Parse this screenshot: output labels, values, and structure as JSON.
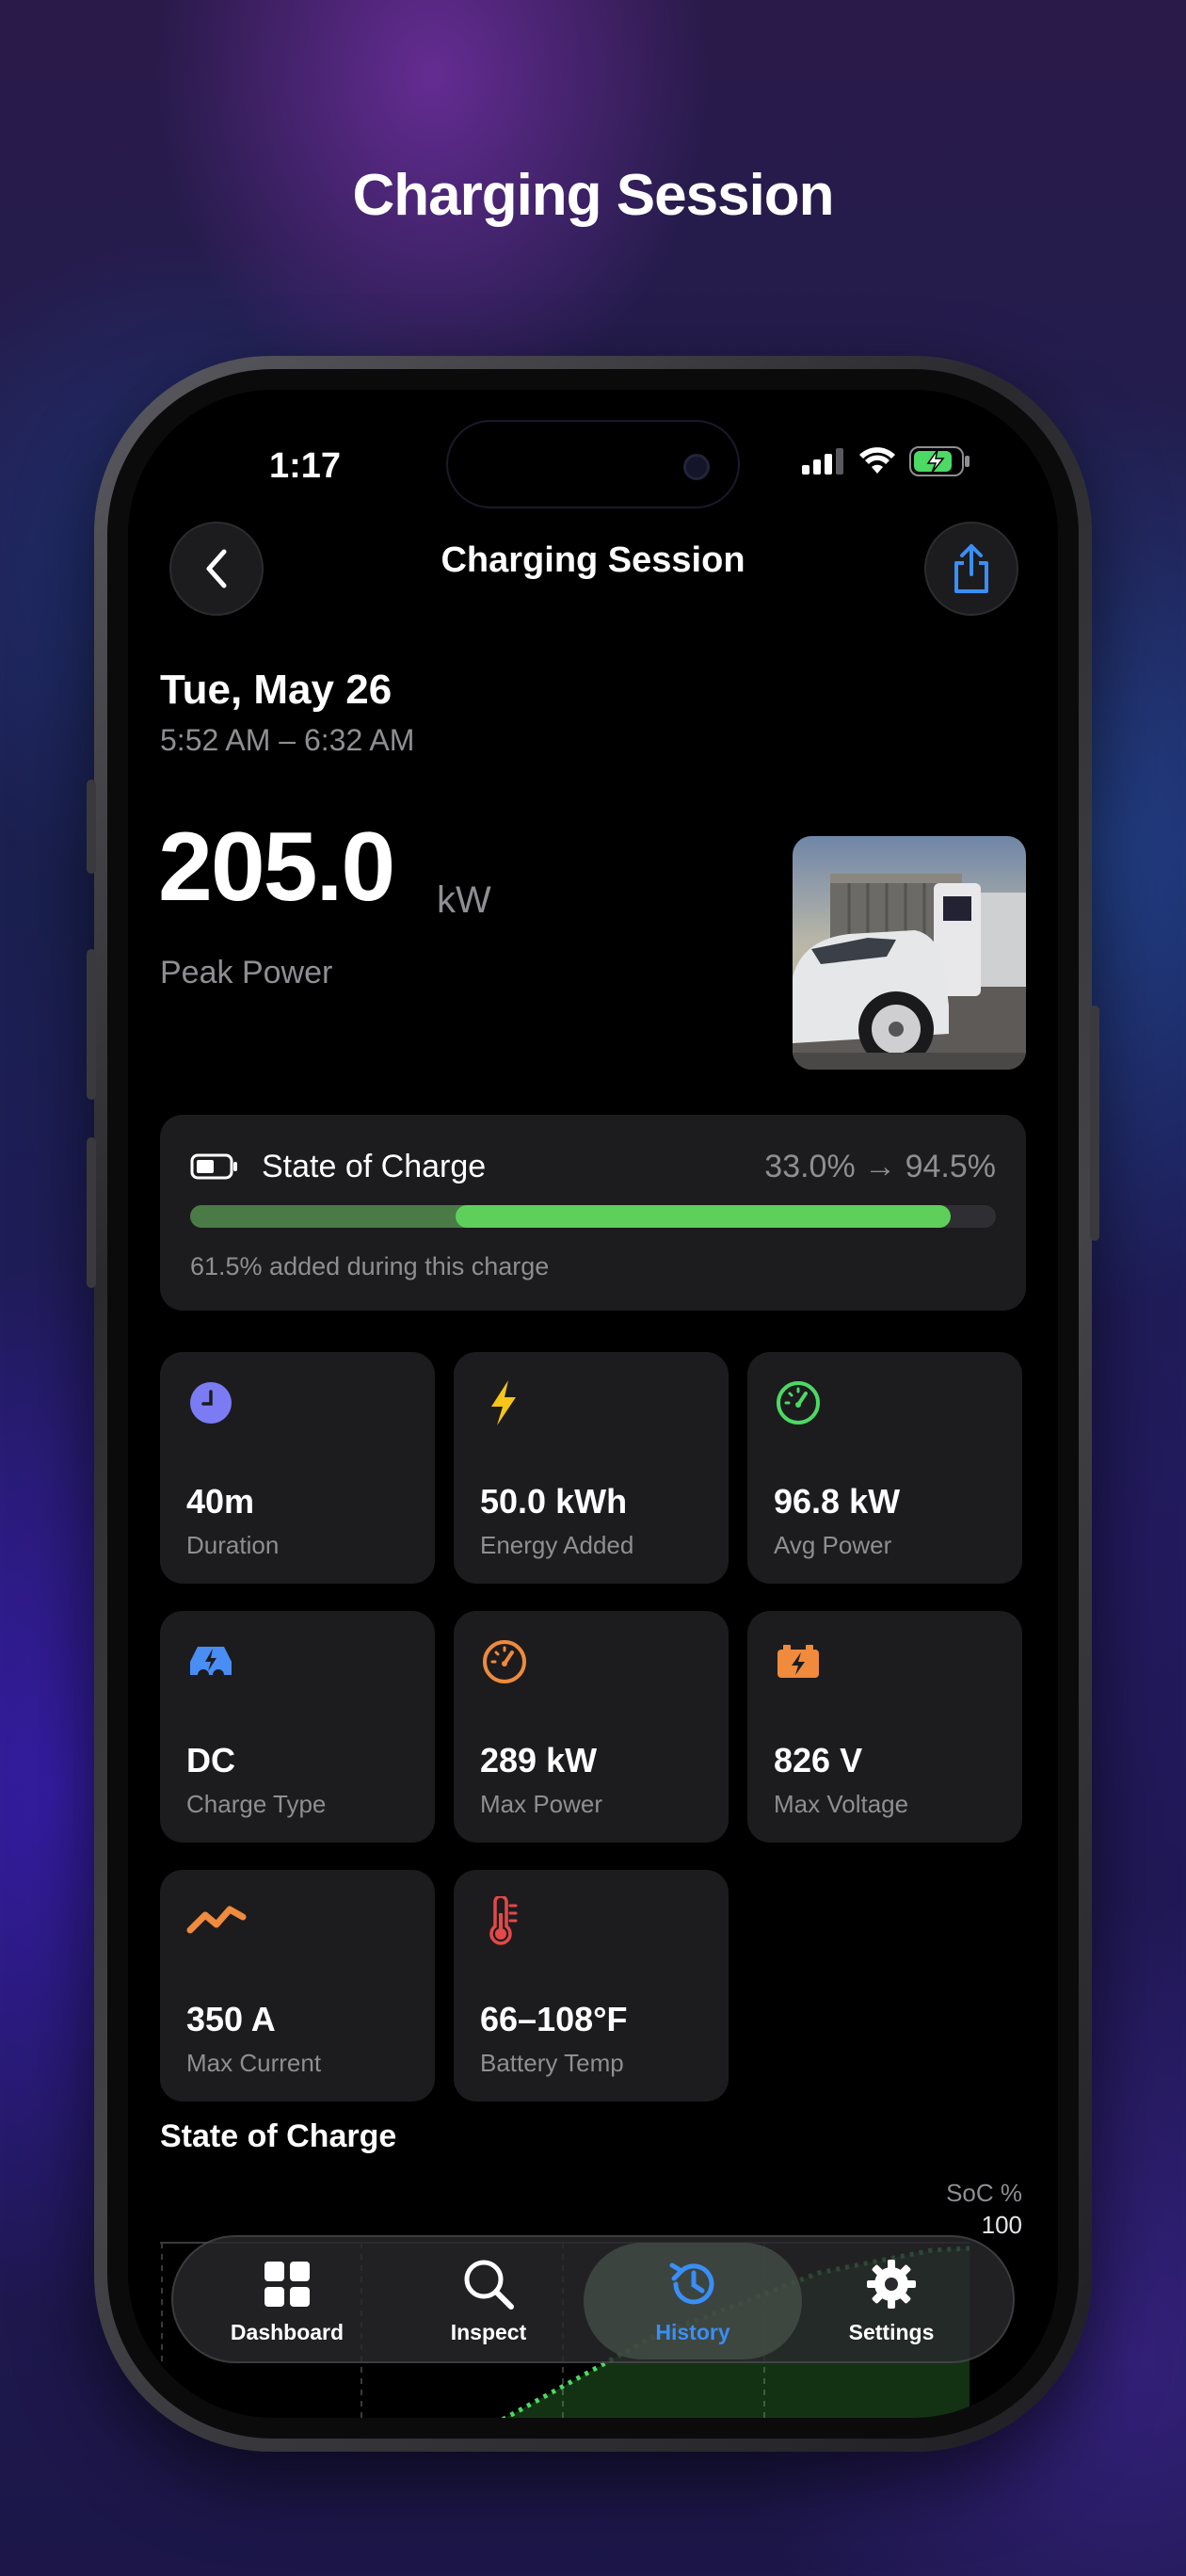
{
  "page": {
    "title": "Charging Session"
  },
  "status_bar": {
    "time": "1:17"
  },
  "nav": {
    "title": "Charging Session"
  },
  "session": {
    "date": "Tue, May 26",
    "time_range": "5:52 AM – 6:32 AM",
    "peak_power": "205.0",
    "peak_unit": "kW",
    "peak_label": "Peak Power"
  },
  "soc": {
    "title": "State of Charge",
    "range": "33.0% → 94.5%",
    "start_percent": 33.0,
    "end_percent": 94.5,
    "note": "61.5% added during this charge"
  },
  "stats": [
    {
      "icon": "clock-icon",
      "value": "40m",
      "label": "Duration",
      "color": "#7b7cf3"
    },
    {
      "icon": "bolt-icon",
      "value": "50.0 kWh",
      "label": "Energy Added",
      "color": "#f5c518"
    },
    {
      "icon": "speedometer-icon",
      "value": "96.8 kW",
      "label": "Avg Power",
      "color": "#4cd964"
    },
    {
      "icon": "car-bolt-icon",
      "value": "DC",
      "label": "Charge Type",
      "color": "#4a8ef5"
    },
    {
      "icon": "gauge-icon",
      "value": "289 kW",
      "label": "Max Power",
      "color": "#f08a3c"
    },
    {
      "icon": "battery-bolt-icon",
      "value": "826 V",
      "label": "Max Voltage",
      "color": "#f08a3c"
    },
    {
      "icon": "waveform-icon",
      "value": "350 A",
      "label": "Max Current",
      "color": "#f08a3c"
    },
    {
      "icon": "thermometer-icon",
      "value": "66–108°F",
      "label": "Battery Temp",
      "color": "#e54848"
    }
  ],
  "chart_section": {
    "title": "State of Charge"
  },
  "chart_data": {
    "type": "area",
    "title": "",
    "ylabel": "SoC %",
    "y_ticks": [
      "100"
    ],
    "ylim": [
      0,
      100
    ]
  },
  "tabs": [
    {
      "label": "Dashboard",
      "icon": "grid-icon",
      "active": false
    },
    {
      "label": "Inspect",
      "icon": "search-icon",
      "active": false
    },
    {
      "label": "History",
      "icon": "history-icon",
      "active": true
    },
    {
      "label": "Settings",
      "icon": "gear-icon",
      "active": false
    }
  ],
  "colors": {
    "accent_blue": "#3a8ef6",
    "green": "#5fcf5c",
    "muted": "#8e8e93",
    "card": "#1c1c1e"
  }
}
